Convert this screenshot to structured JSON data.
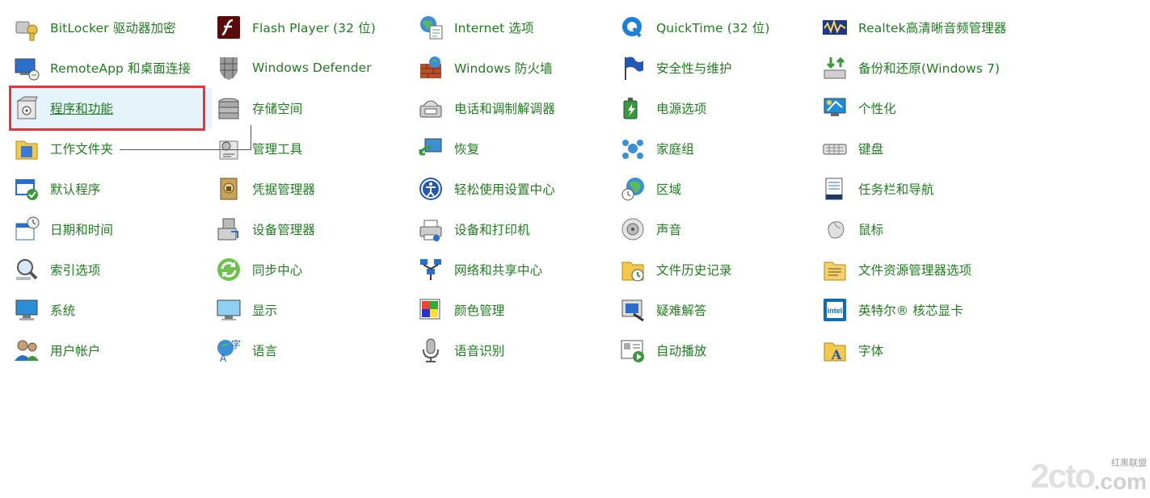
{
  "window": {
    "view": "Control Panel - All Control Panel Items (small icons)"
  },
  "colors": {
    "link": "#1f7d1f",
    "highlight_bg": "#e5f3fb",
    "annotation_box": "#e8343a"
  },
  "items": [
    {
      "label": "BitLocker 驱动器加密",
      "icon": "bitlocker-icon"
    },
    {
      "label": "Flash Player (32 位)",
      "icon": "flash-player-icon"
    },
    {
      "label": "Internet 选项",
      "icon": "internet-options-icon"
    },
    {
      "label": "QuickTime (32 位)",
      "icon": "quicktime-icon"
    },
    {
      "label": "Realtek高清晰音频管理器",
      "icon": "realtek-audio-icon"
    },
    {
      "label": "RemoteApp 和桌面连接",
      "icon": "remoteapp-icon"
    },
    {
      "label": "Windows Defender",
      "icon": "windows-defender-icon"
    },
    {
      "label": "Windows 防火墙",
      "icon": "firewall-icon"
    },
    {
      "label": "安全性与维护",
      "icon": "security-maintenance-flag-icon"
    },
    {
      "label": "备份和还原(Windows 7)",
      "icon": "backup-restore-icon"
    },
    {
      "label": "程序和功能",
      "icon": "programs-features-icon",
      "highlighted": true
    },
    {
      "label": "存储空间",
      "icon": "storage-spaces-icon"
    },
    {
      "label": "电话和调制解调器",
      "icon": "phone-modem-icon"
    },
    {
      "label": "电源选项",
      "icon": "power-options-icon"
    },
    {
      "label": "个性化",
      "icon": "personalization-icon"
    },
    {
      "label": "工作文件夹",
      "icon": "work-folders-icon"
    },
    {
      "label": "管理工具",
      "icon": "admin-tools-icon"
    },
    {
      "label": "恢复",
      "icon": "recovery-icon"
    },
    {
      "label": "家庭组",
      "icon": "homegroup-icon"
    },
    {
      "label": "键盘",
      "icon": "keyboard-icon"
    },
    {
      "label": "默认程序",
      "icon": "default-programs-icon"
    },
    {
      "label": "凭据管理器",
      "icon": "credential-manager-icon"
    },
    {
      "label": "轻松使用设置中心",
      "icon": "ease-of-access-icon"
    },
    {
      "label": "区域",
      "icon": "region-icon"
    },
    {
      "label": "任务栏和导航",
      "icon": "taskbar-navigation-icon"
    },
    {
      "label": "日期和时间",
      "icon": "date-time-icon"
    },
    {
      "label": "设备管理器",
      "icon": "device-manager-icon"
    },
    {
      "label": "设备和打印机",
      "icon": "devices-printers-icon"
    },
    {
      "label": "声音",
      "icon": "sound-icon"
    },
    {
      "label": "鼠标",
      "icon": "mouse-icon"
    },
    {
      "label": "索引选项",
      "icon": "indexing-options-icon"
    },
    {
      "label": "同步中心",
      "icon": "sync-center-icon"
    },
    {
      "label": "网络和共享中心",
      "icon": "network-sharing-icon"
    },
    {
      "label": "文件历史记录",
      "icon": "file-history-icon"
    },
    {
      "label": "文件资源管理器选项",
      "icon": "file-explorer-options-icon"
    },
    {
      "label": "系统",
      "icon": "system-icon"
    },
    {
      "label": "显示",
      "icon": "display-icon"
    },
    {
      "label": "颜色管理",
      "icon": "color-management-icon"
    },
    {
      "label": "疑难解答",
      "icon": "troubleshooting-icon"
    },
    {
      "label": "英特尔® 核芯显卡",
      "icon": "intel-graphics-icon"
    },
    {
      "label": "用户帐户",
      "icon": "user-accounts-icon"
    },
    {
      "label": "语言",
      "icon": "language-icon"
    },
    {
      "label": "语音识别",
      "icon": "speech-recognition-icon"
    },
    {
      "label": "自动播放",
      "icon": "autoplay-icon"
    },
    {
      "label": "字体",
      "icon": "fonts-icon"
    }
  ],
  "watermark": {
    "main": "2cto",
    "suffix": ".com",
    "tag": "红黑联盟"
  }
}
